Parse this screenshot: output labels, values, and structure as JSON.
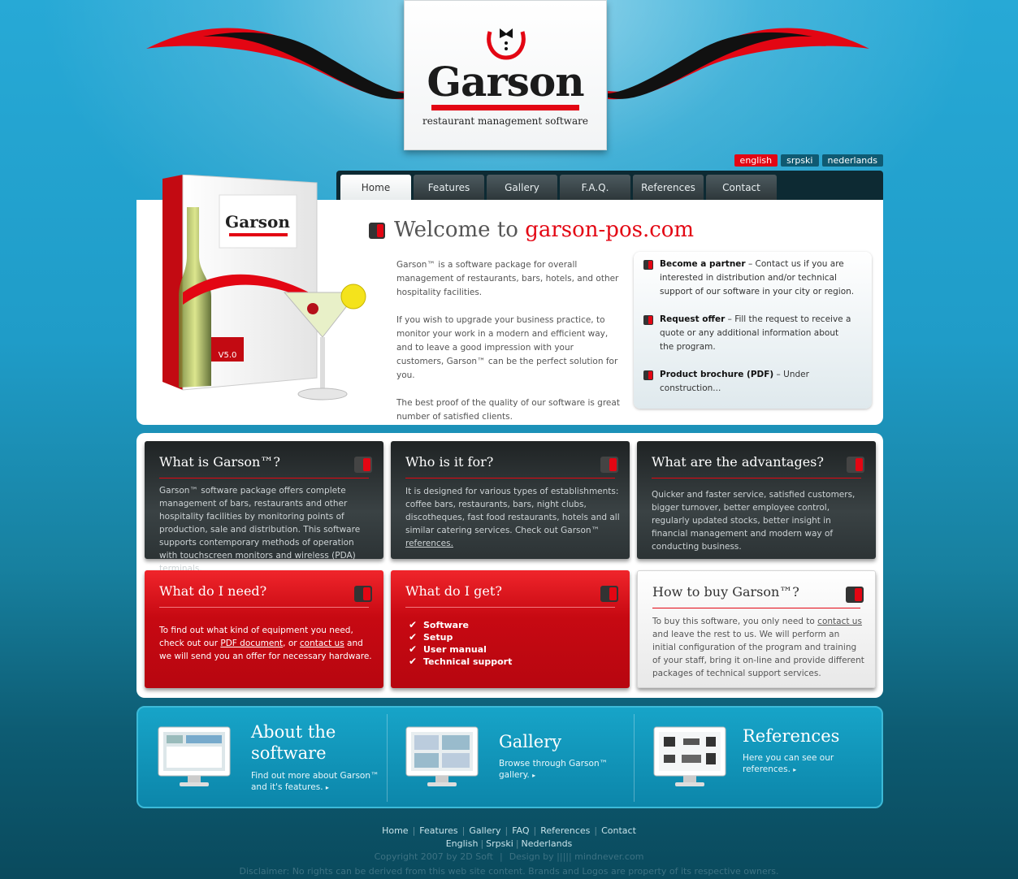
{
  "brand": {
    "name": "Garson",
    "tagline": "restaurant management software"
  },
  "languages": [
    {
      "label": "english",
      "active": true
    },
    {
      "label": "srpski",
      "active": false
    },
    {
      "label": "nederlands",
      "active": false
    }
  ],
  "nav": {
    "tabs": [
      {
        "label": "Home",
        "active": true
      },
      {
        "label": "Features",
        "active": false
      },
      {
        "label": "Gallery",
        "active": false
      },
      {
        "label": "F.A.Q.",
        "active": false
      },
      {
        "label": "References",
        "active": false
      },
      {
        "label": "Contact",
        "active": false
      }
    ]
  },
  "welcome": {
    "title_prefix": "Welcome to ",
    "title_site": "garson-pos.com",
    "box_brand": "Garson",
    "box_version": "V5.0",
    "paragraphs": [
      "Garson™ is a software package for overall management of restaurants, bars, hotels, and other hospitality facilities.",
      "If you wish to upgrade your business practice, to monitor your work in a modern and efficient way, and to leave a good impression with your customers, Garson™ can be the perfect solution for you.",
      "The best proof of the quality of our software is great number of satisfied clients."
    ]
  },
  "side_box": {
    "items": [
      {
        "title": "Become a partner",
        "text": " – Contact us if you are interested in distribution and/or technical support of our software in your city or region."
      },
      {
        "title": "Request offer",
        "text": " – Fill the request to receive a quote or any additional information about the program."
      },
      {
        "title": "Product brochure (PDF)",
        "text": " – Under construction..."
      }
    ]
  },
  "cards": {
    "what_is": {
      "title": "What is Garson™?",
      "body": "Garson™ software package offers complete management of bars, restaurants and other hospitality facilities by monitoring points of production, sale and distribution. This software supports contemporary methods of operation with touchscreen monitors and wireless (PDA) terminals."
    },
    "who_for": {
      "title": "Who is it for?",
      "body": "It is designed for various types of establishments: coffee bars, restaurants, bars, night clubs, discotheques, fast food restaurants, hotels and all similar catering services. Check out Garson™ ",
      "link": "references."
    },
    "advantages": {
      "title": "What are the advantages?",
      "body": "Quicker and faster service, satisfied customers, bigger turnover, better employee control, regularly updated stocks, better insight in financial management and modern way of conducting business."
    },
    "need": {
      "title": "What do I need?",
      "body_1": "To find out what kind of equipment you need, check out our ",
      "link_1": "PDF document",
      "body_2": ", or ",
      "link_2": "contact us",
      "body_3": " and we will send you an offer for necessary hardware."
    },
    "get": {
      "title": "What do I get?",
      "items": [
        "Software",
        "Setup",
        "User manual",
        "Technical support"
      ]
    },
    "buy": {
      "title": "How to buy Garson™?",
      "body_1": "To buy this software, you only need to ",
      "link": "contact us ",
      "body_2": "and leave the rest to us. We will perform an initial configuration of the program and training of your staff, bring it on-line and provide different packages of technical support services."
    }
  },
  "promo": [
    {
      "title": "About the software",
      "text": "Find out more about Garson™ and it's features.",
      "arrow": "▸"
    },
    {
      "title": "Gallery",
      "text": "Browse through Garson™ gallery.",
      "arrow": "▸"
    },
    {
      "title": "References",
      "text": "Here you can see our references.",
      "arrow": "▸"
    }
  ],
  "footer": {
    "links": [
      "Home",
      "Features",
      "Gallery",
      "FAQ",
      "References",
      "Contact"
    ],
    "lang_links": [
      "English",
      "Srpski",
      "Nederlands"
    ],
    "copyright": "Copyright 2007 by 2D Soft",
    "design": "Design by ||||| mindnever.com",
    "disclaimer": "Disclaimer: No rights can be derived from this web site content. Brands and Logos are property of its respective owners."
  },
  "colors": {
    "accent_red": "#e30613",
    "dark_card": "#2c3335",
    "sky_blue": "#1f9cc8"
  }
}
